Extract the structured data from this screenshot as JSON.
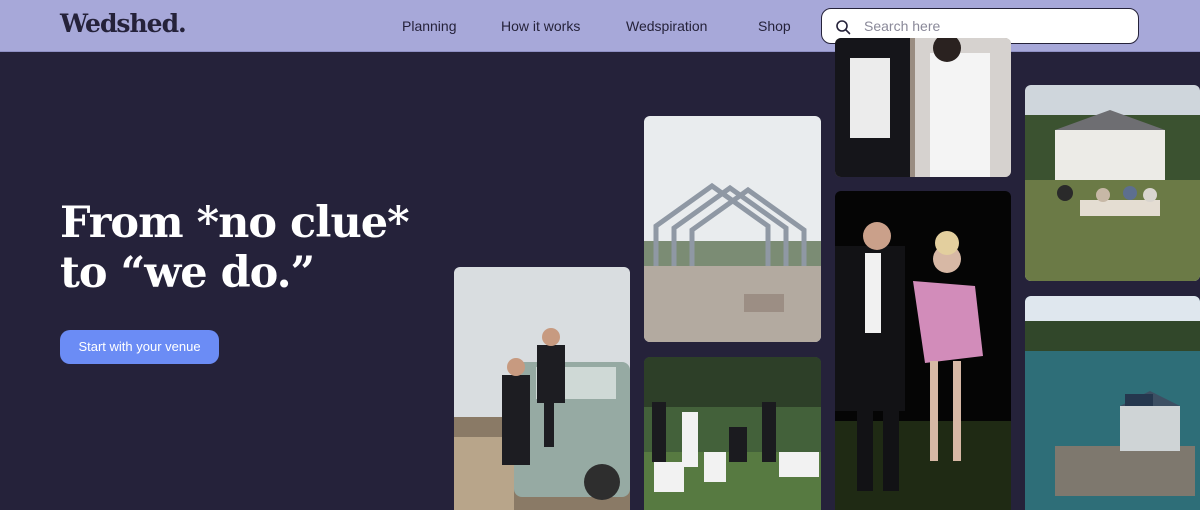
{
  "brand": {
    "logo_text": "Wedshed."
  },
  "nav": {
    "items": [
      {
        "label": "Planning"
      },
      {
        "label": "How it works"
      },
      {
        "label": "Wedspiration"
      },
      {
        "label": "Shop"
      }
    ]
  },
  "search": {
    "placeholder": "Search here",
    "value": ""
  },
  "hero": {
    "headline_line1": "From *no clue*",
    "headline_line2": "to “we do.”",
    "cta_label": "Start with your venue"
  },
  "colors": {
    "nav_background": "#a7a8d9",
    "page_background": "#25223a",
    "cta_background": "#6b8cf5",
    "headline_text": "#ffffff"
  }
}
